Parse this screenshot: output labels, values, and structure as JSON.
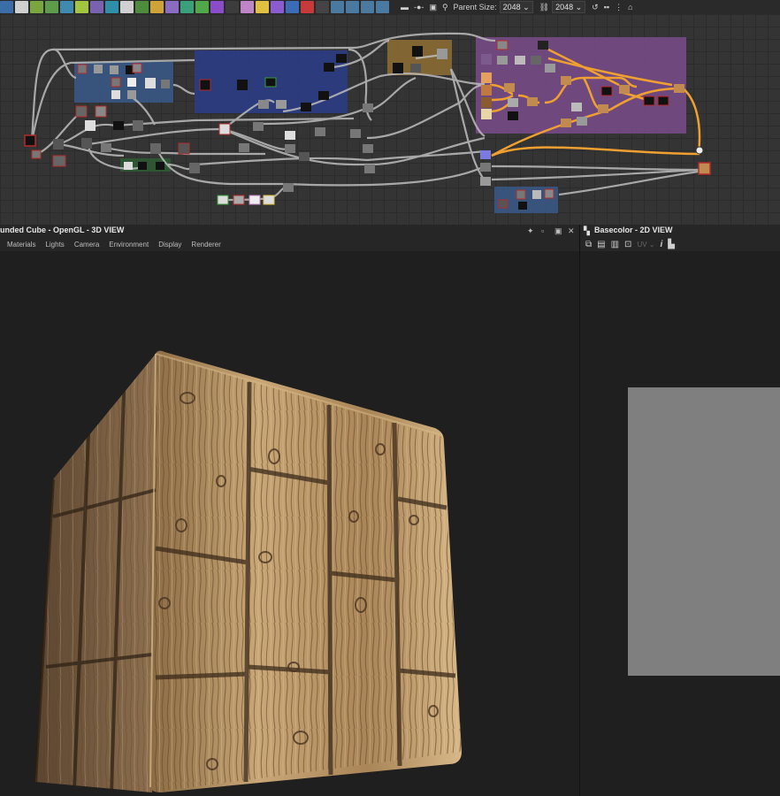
{
  "toolbar": {
    "parent_size_label": "Parent Size:",
    "width_value": "2048",
    "height_value": "2048"
  },
  "view3d": {
    "title": "unded Cube - OpenGL - 3D VIEW",
    "menu": [
      "Materials",
      "Lights",
      "Camera",
      "Environment",
      "Display",
      "Renderer"
    ]
  },
  "view2d": {
    "title": "Basecolor - 2D VIEW",
    "uv_label": "UV"
  },
  "colors": {
    "frame_blue": "#3a5a8a",
    "frame_navy": "#2a3d8a",
    "frame_brown": "#8a6a32",
    "frame_purple": "#7a4d8c",
    "link_orange": "#f0a030",
    "link_grey": "#bdbdbd",
    "accent_red": "#b42a2a"
  },
  "icons": [
    "pin-icon",
    "maximize-icon",
    "restore-icon",
    "close-icon",
    "save-icon",
    "copy-icon",
    "info-icon",
    "histogram-icon"
  ]
}
